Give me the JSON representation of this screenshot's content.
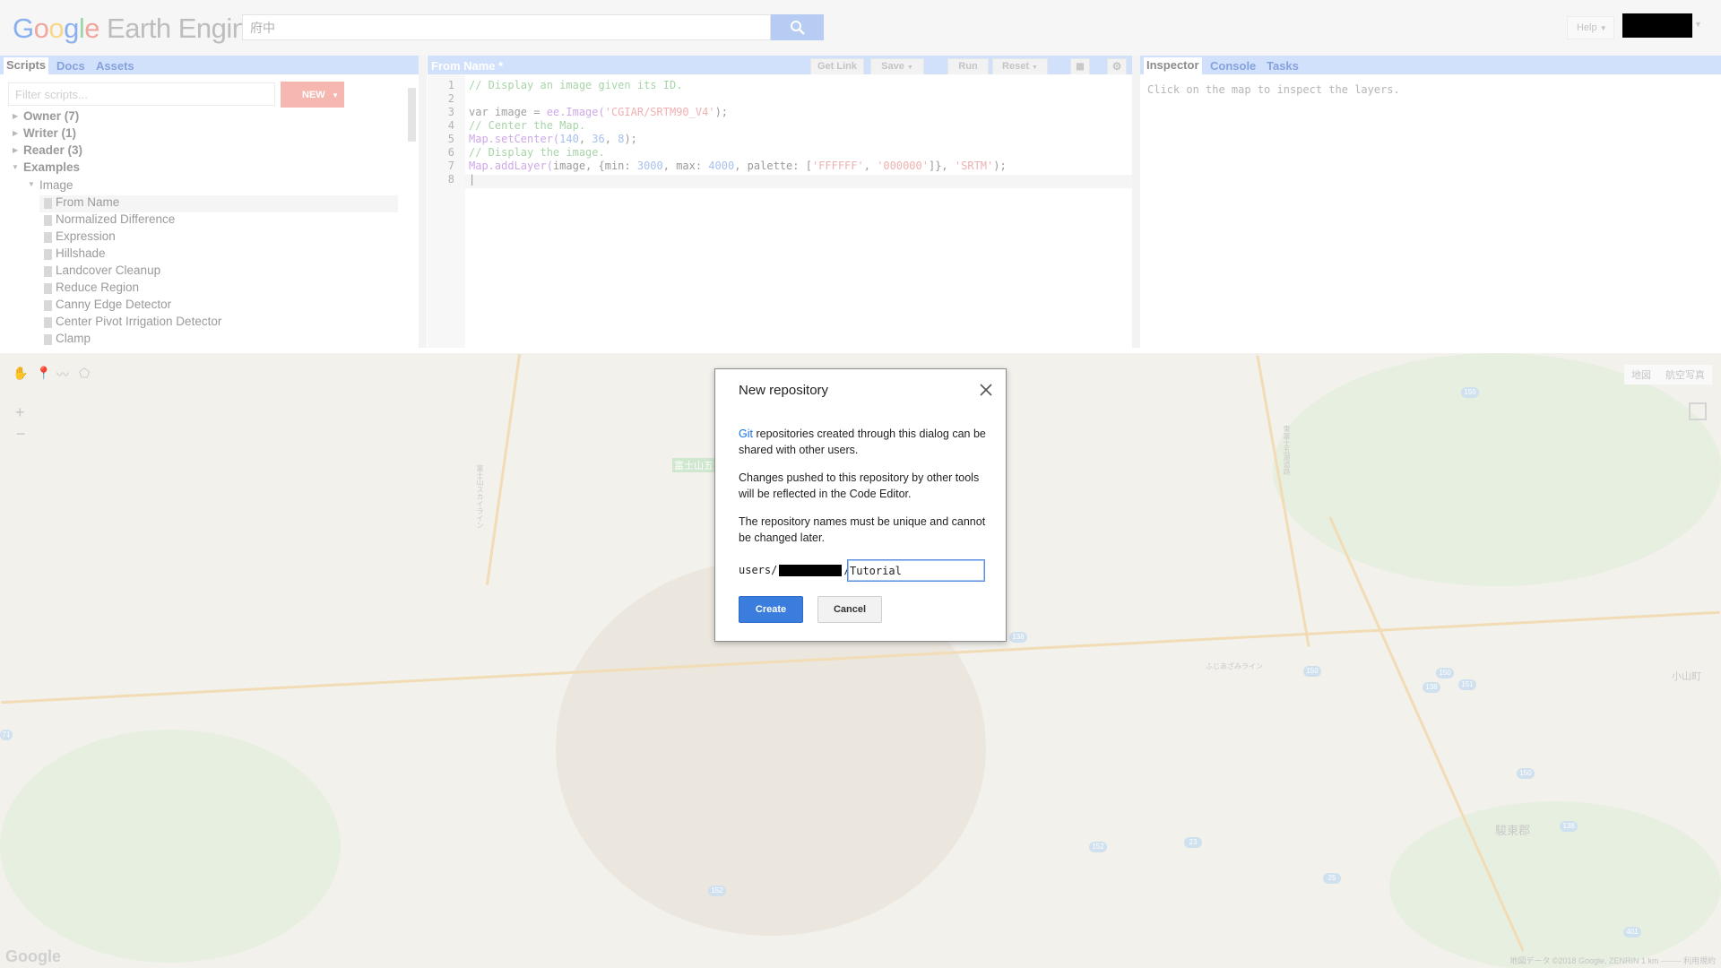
{
  "header": {
    "logo_text": {
      "g1": "G",
      "g2": "o",
      "g3": "o",
      "g4": "g",
      "g5": "l",
      "g6": "e",
      "rest": "Earth Engine"
    },
    "search_value": "府中",
    "help_label": "Help"
  },
  "left_panel": {
    "tabs": [
      "Scripts",
      "Docs",
      "Assets"
    ],
    "filter_placeholder": "Filter scripts...",
    "new_label": "NEW",
    "tree": {
      "owner": "Owner  (7)",
      "writer": "Writer  (1)",
      "reader": "Reader  (3)",
      "examples": "Examples",
      "image": "Image",
      "files": [
        "From Name",
        "Normalized Difference",
        "Expression",
        "Hillshade",
        "Landcover Cleanup",
        "Reduce Region",
        "Canny Edge Detector",
        "Center Pivot Irrigation Detector",
        "Clamp"
      ]
    }
  },
  "editor": {
    "title": "From Name *",
    "buttons": {
      "get_link": "Get Link",
      "save": "Save",
      "run": "Run",
      "reset": "Reset"
    },
    "line_numbers": [
      "1",
      "2",
      "3",
      "4",
      "5",
      "6",
      "7",
      "8"
    ],
    "code": {
      "l1": "// Display an image given its ID.",
      "l3_kw": "var image = ",
      "l3_fn": "ee.Image(",
      "l3_str": "'CGIAR/SRTM90_V4'",
      "l3_end": ");",
      "l4": "// Center the Map.",
      "l5_fn": "Map.setCenter(",
      "l5_a": "140",
      "l5_b": "36",
      "l5_c": "8",
      "l5_end": ");",
      "l6": "// Display the image.",
      "l7_fn": "Map.addLayer(",
      "l7_a": "image, {min: ",
      "l7_min": "3000",
      "l7_b": ", max: ",
      "l7_max": "4000",
      "l7_c": ", palette: [",
      "l7_p1": "'FFFFFF'",
      "l7_d": ", ",
      "l7_p2": "'000000'",
      "l7_e": "]}, ",
      "l7_name": "'SRTM'",
      "l7_end": ");"
    }
  },
  "right_panel": {
    "tabs": [
      "Inspector",
      "Console",
      "Tasks"
    ],
    "message": "Click on the map to inspect the layers."
  },
  "map": {
    "map_types": [
      "地図",
      "航空写真"
    ],
    "labels": {
      "label_1": "富士山五合目",
      "label_2": "小山町",
      "label_3": "駿東郡",
      "label_4": "ふじあざみライン",
      "label_5": "富士山スカイライン",
      "label_6": "東富士五湖道路"
    },
    "badges": [
      "150",
      "138",
      "150",
      "150",
      "151",
      "138",
      "150",
      "138",
      "152",
      "23",
      "25",
      "401",
      "152",
      "71"
    ],
    "attribution": "地図データ ©2018 Google, ZENRIN   1 km ⎯⎯⎯⎯⎯   利用規約",
    "watermark": "Google"
  },
  "dialog": {
    "title": "New repository",
    "git_link": "Git",
    "p1_rest": " repositories created through this dialog can be shared with other users.",
    "p2": "Changes pushed to this repository by other tools will be reflected in the Code Editor.",
    "p3": "The repository names must be unique and cannot be changed later.",
    "prefix_a": "users/",
    "prefix_b": "/",
    "repo_name": "Tutorial",
    "create_label": "Create",
    "cancel_label": "Cancel"
  },
  "colors": {
    "accent": "#3b7ddd",
    "tab_bar": "#d2e1fb",
    "link": "#1a73e8"
  }
}
